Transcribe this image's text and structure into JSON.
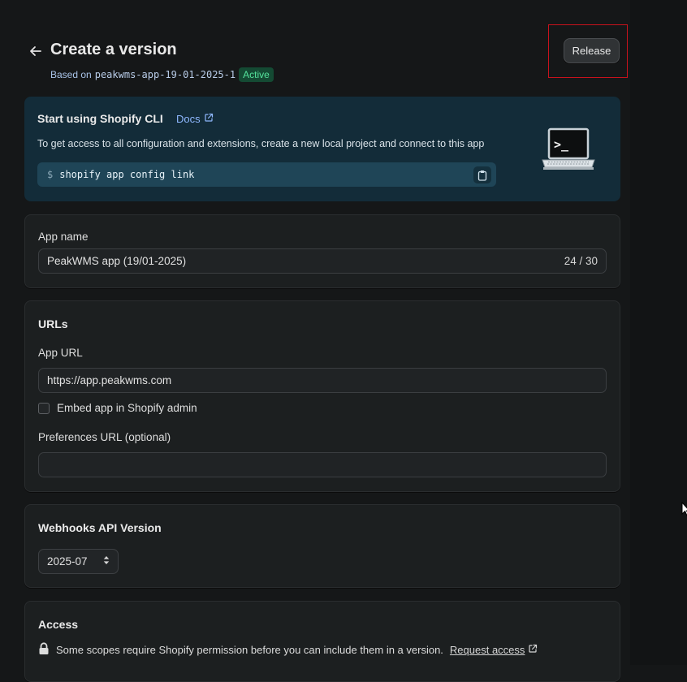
{
  "header": {
    "title": "Create a version",
    "based_on_label": "Based on",
    "based_on_version": "peakwms-app-19-01-2025-1",
    "status_badge": "Active",
    "release_label": "Release"
  },
  "cli_banner": {
    "title": "Start using Shopify CLI",
    "docs_label": "Docs",
    "description": "To get access to all configuration and extensions, create a new local project and connect to this app",
    "prompt": "$",
    "command": "shopify app config link",
    "terminal_glyph": ">_"
  },
  "app_name": {
    "label": "App name",
    "value": "PeakWMS app (19/01-2025)",
    "counter": "24 / 30"
  },
  "urls": {
    "title": "URLs",
    "app_url_label": "App URL",
    "app_url_value": "https://app.peakwms.com",
    "embed_label": "Embed app in Shopify admin",
    "embed_checked": false,
    "preferences_label": "Preferences URL (optional)",
    "preferences_value": ""
  },
  "webhooks": {
    "title": "Webhooks API Version",
    "selected": "2025-07"
  },
  "access": {
    "title": "Access",
    "notice": "Some scopes require Shopify permission before you can include them in a version.",
    "link_label": "Request access"
  },
  "colors": {
    "accent_active": "#55e39c",
    "highlight_border": "#c8121c",
    "cli_background": "#132c39"
  }
}
